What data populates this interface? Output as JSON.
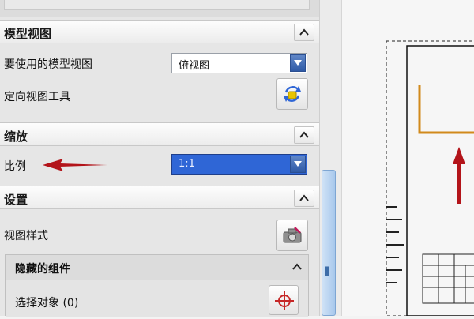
{
  "sections": {
    "model_view": {
      "title": "模型视图"
    },
    "scale": {
      "title": "缩放"
    },
    "settings": {
      "title": "设置"
    }
  },
  "model_view": {
    "view_label": "要使用的模型视图",
    "view_value": "俯视图",
    "orient_label": "定向视图工具"
  },
  "scale": {
    "label": "比例",
    "value": "1:1"
  },
  "settings": {
    "view_style_label": "视图样式",
    "hidden_components": {
      "title": "隐藏的组件",
      "select_object_label": "选择对象 (0)"
    }
  },
  "colors": {
    "annotation_arrow": "#b3141a",
    "selection_blue": "#2f66d6",
    "drawing_orange": "#d18a1c"
  }
}
